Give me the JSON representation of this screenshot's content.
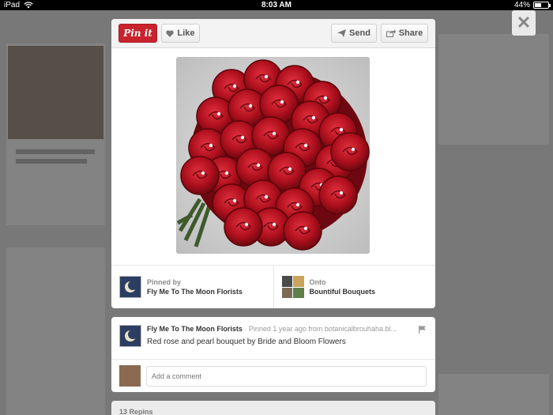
{
  "status_bar": {
    "device": "iPad",
    "time": "8:03 AM",
    "battery": "44%",
    "battery_level": 0.44
  },
  "close": {
    "label": "✕"
  },
  "toolbar": {
    "pinit_label": "Pin it",
    "like_label": "Like",
    "send_label": "Send",
    "share_label": "Share"
  },
  "pin": {
    "pinned_by_label": "Pinned by",
    "pinned_by_name": "Fly Me To The Moon Florists",
    "onto_label": "Onto",
    "board_name": "Bountiful Bouquets"
  },
  "description": {
    "author": "Fly Me To The Moon Florists",
    "meta": " · Pinned 1 year ago from botanicalbrouhaha.bl...",
    "text": "Red rose and pearl bouquet by Bride and Bloom Flowers"
  },
  "comment": {
    "placeholder": "Add a comment"
  },
  "repins": {
    "label": "13 Repins"
  },
  "colors": {
    "pinterest_red": "#c8232c",
    "rose": "#b0101e"
  }
}
